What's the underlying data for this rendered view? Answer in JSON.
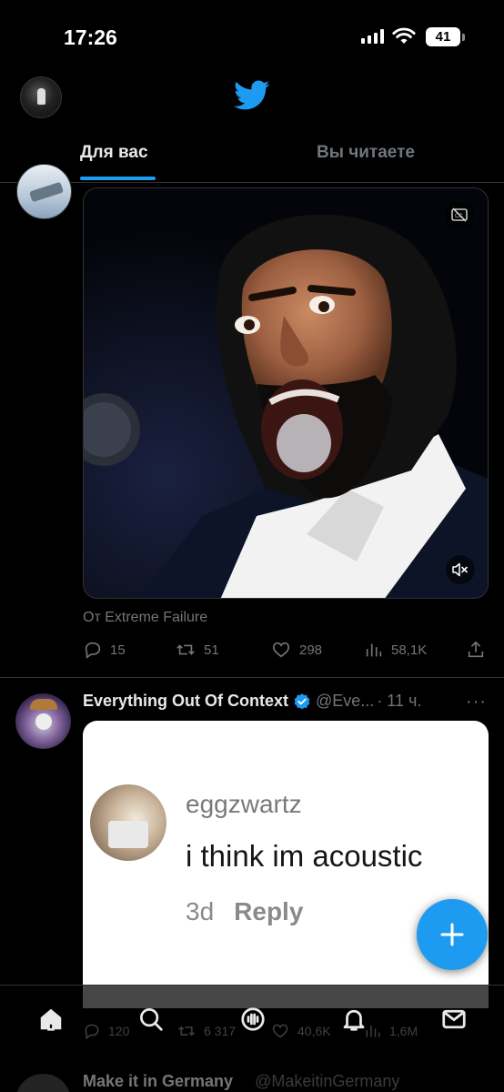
{
  "status_bar": {
    "time": "17:26",
    "battery": "41"
  },
  "header": {
    "logo": "twitter-bird-icon",
    "accent": "#1d9bf0"
  },
  "tabs": [
    {
      "label": "Для вас",
      "active": true
    },
    {
      "label": "Вы читаете",
      "active": false
    }
  ],
  "tweet1": {
    "source": "От Extreme Failure",
    "media_icons": [
      "closed-captions-icon",
      "muted-speaker-icon"
    ],
    "stats": {
      "replies": "15",
      "retweets": "51",
      "likes": "298",
      "views": "58,1K"
    }
  },
  "tweet2": {
    "name": "Everything Out Of Context",
    "handle": "@Eve...",
    "time": "· 11 ч.",
    "verified": true,
    "card": {
      "username": "eggzwartz",
      "comment": "i think im acoustic",
      "age": "3d",
      "reply_label": "Reply"
    },
    "stats": {
      "replies": "120",
      "retweets": "6 317",
      "likes": "40,6K",
      "views": "1,6M"
    }
  },
  "next_tweet": {
    "name": "Make it in Germany",
    "handle": "@MakeitinGermany"
  },
  "fab": {
    "icon": "plus-icon"
  },
  "bottom_nav": [
    {
      "name": "home-icon",
      "active": true
    },
    {
      "name": "search-icon"
    },
    {
      "name": "spaces-icon"
    },
    {
      "name": "notifications-icon"
    },
    {
      "name": "messages-icon"
    }
  ]
}
